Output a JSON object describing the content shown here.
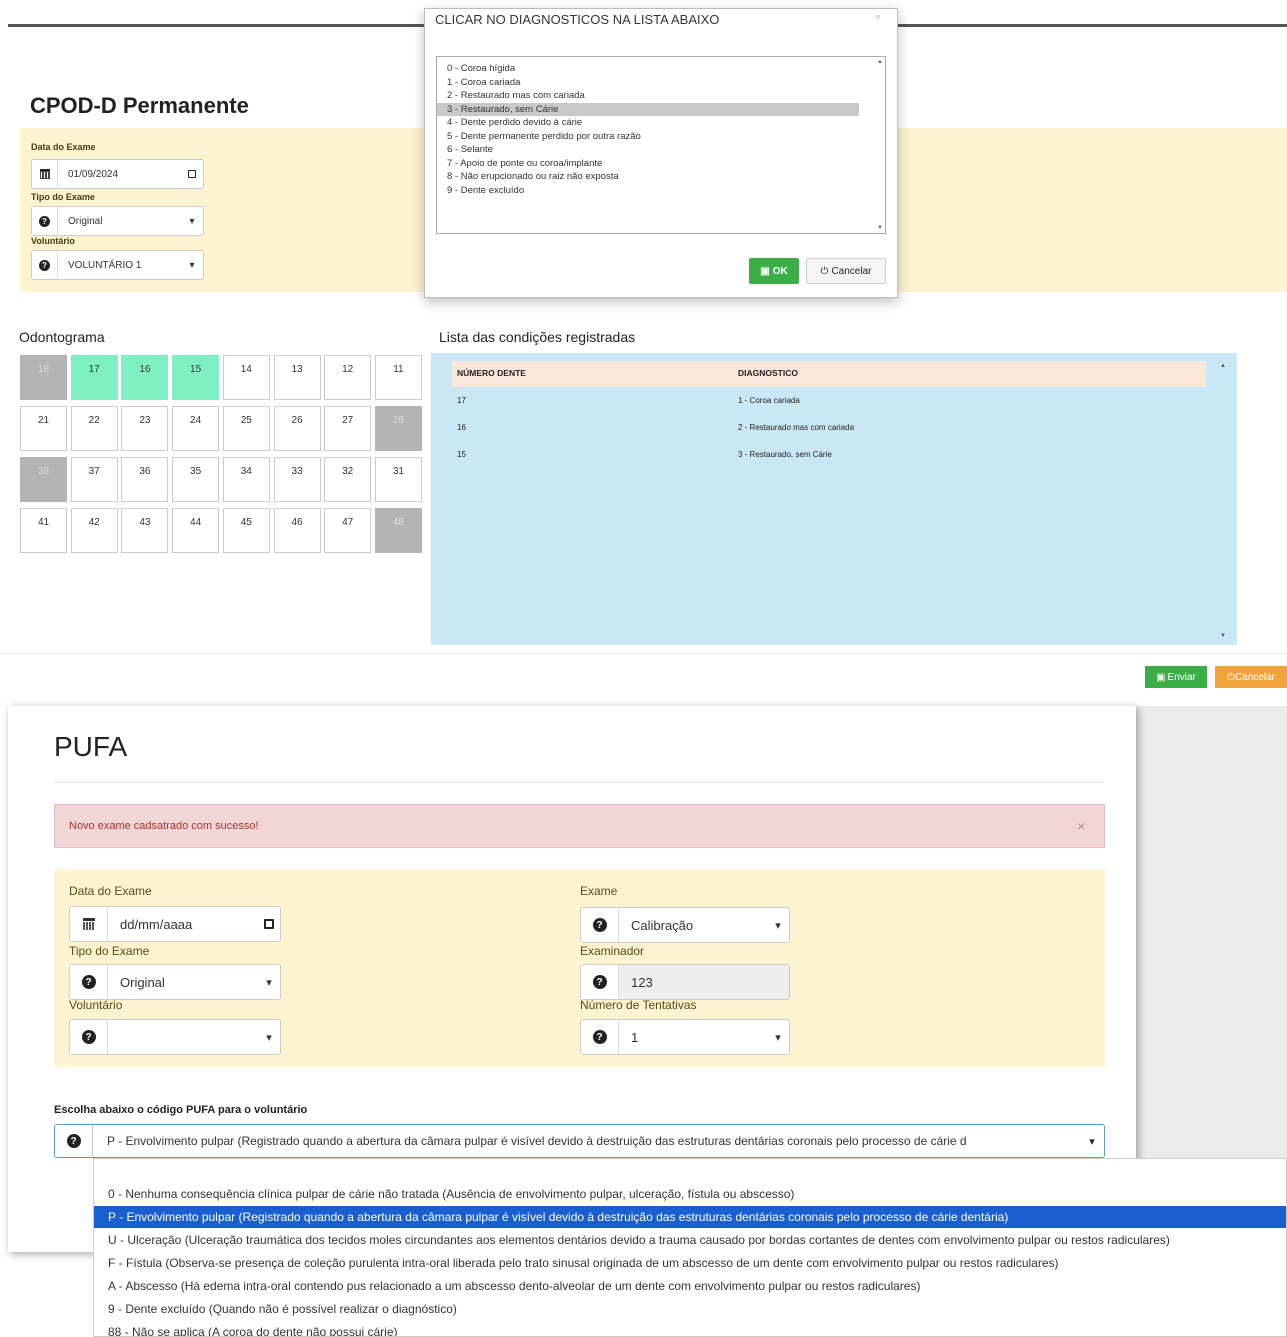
{
  "cpod": {
    "title": "CPOD-D Permanente",
    "date_label": "Data do Exame",
    "date_value": "01/09/2024",
    "tipo_label": "Tipo do Exame",
    "tipo_value": "Original",
    "vol_label": "Voluntário",
    "vol_value": "VOLUNTÁRIO 1"
  },
  "modal": {
    "title": "CLICAR NO DIAGNOSTICOS NA LISTA ABAIXO",
    "close": "×",
    "options": [
      "0 - Coroa hígida",
      "1 - Coroa cariada",
      "2 - Restaurado mas com cariada",
      "3 - Restaurado, sem Cárie",
      "4 - Dente perdido devido à cárie",
      "5 - Dente permanente perdido por outra razão",
      "6 - Selante",
      "7 - Apoio de ponte ou coroa/implante",
      "8 - Não erupcionado ou raiz não exposta",
      "9 - Dente excluído"
    ],
    "selected_index": 3,
    "ok_label": "OK",
    "cancel_label": "Cancelar"
  },
  "odontograma": {
    "title": "Odontograma",
    "rows": [
      [
        {
          "n": "18",
          "s": "x"
        },
        {
          "n": "17",
          "s": "g"
        },
        {
          "n": "16",
          "s": "g"
        },
        {
          "n": "15",
          "s": "g"
        },
        {
          "n": "14",
          "s": ""
        },
        {
          "n": "13",
          "s": ""
        },
        {
          "n": "12",
          "s": ""
        },
        {
          "n": "11",
          "s": ""
        }
      ],
      [
        {
          "n": "21",
          "s": ""
        },
        {
          "n": "22",
          "s": ""
        },
        {
          "n": "23",
          "s": ""
        },
        {
          "n": "24",
          "s": ""
        },
        {
          "n": "25",
          "s": ""
        },
        {
          "n": "26",
          "s": ""
        },
        {
          "n": "27",
          "s": ""
        },
        {
          "n": "28",
          "s": "x"
        }
      ],
      [
        {
          "n": "38",
          "s": "x"
        },
        {
          "n": "37",
          "s": ""
        },
        {
          "n": "36",
          "s": ""
        },
        {
          "n": "35",
          "s": ""
        },
        {
          "n": "34",
          "s": ""
        },
        {
          "n": "33",
          "s": ""
        },
        {
          "n": "32",
          "s": ""
        },
        {
          "n": "31",
          "s": ""
        }
      ],
      [
        {
          "n": "41",
          "s": ""
        },
        {
          "n": "42",
          "s": ""
        },
        {
          "n": "43",
          "s": ""
        },
        {
          "n": "44",
          "s": ""
        },
        {
          "n": "45",
          "s": ""
        },
        {
          "n": "46",
          "s": ""
        },
        {
          "n": "47",
          "s": ""
        },
        {
          "n": "48",
          "s": "x"
        }
      ]
    ]
  },
  "lista": {
    "title": "Lista das condições registradas",
    "col1": "NÚMERO DENTE",
    "col2": "DIAGNOSTICO",
    "rows": [
      {
        "dente": "17",
        "diag": "1 - Coroa cariada"
      },
      {
        "dente": "16",
        "diag": "2 - Restaurado mas com cariada"
      },
      {
        "dente": "15",
        "diag": "3 - Restaurado, sem Cárie"
      }
    ]
  },
  "actions": {
    "enviar": "Enviar",
    "cancelar": "Cancelar"
  },
  "pufa": {
    "title": "PUFA",
    "alert": "Novo exame cadsatrado com sucesso!",
    "alert_close": "×",
    "date_label": "Data do Exame",
    "date_placeholder": "dd/mm/aaaa",
    "tipo_label": "Tipo do Exame",
    "tipo_value": "Original",
    "vol_label": "Voluntário",
    "vol_value": "",
    "exame_label": "Exame",
    "exame_value": "Calibração",
    "examinador_label": "Examinador",
    "examinador_value": "123",
    "tentativas_label": "Número de Tentativas",
    "tentativas_value": "1",
    "choose_label": "Escolha abaixo o código PUFA para o voluntário",
    "selected_value": "P - Envolvimento pulpar (Registrado quando a abertura da câmara pulpar é visível devido à destruição das estruturas dentárias coronais pelo processo de cárie d",
    "options": [
      "0 - Nenhuma consequência clínica pulpar de cárie não tratada (Ausência de envolvimento pulpar, ulceração, fístula ou abscesso)",
      "P - Envolvimento pulpar (Registrado quando a abertura da câmara pulpar é visível devido à destruição das estruturas dentárias coronais pelo processo de cárie dentária)",
      "U - Ulceração (Ulceração traumática dos tecidos moles circundantes aos elementos dentários devido a trauma causado por bordas cortantes de dentes com envolvimento pulpar ou restos radiculares)",
      "F - Fístula (Observa-se presença de coleção purulenta intra-oral liberada pelo trato sinusal originada de um abscesso de um dente com envolvimento pulpar ou restos radiculares)",
      "A - Abscesso (Há edema intra-oral contendo pus relacionado a um abscesso dento-alveolar de um dente com envolvimento pulpar ou restos radiculares)",
      "9 - Dente excluído (Quando não é possível realizar o diagnóstico)",
      "88 - Não se aplica (A coroa do dente não possui cárie)"
    ],
    "selected_index": 1
  },
  "icons": {
    "question": "?",
    "chevron": "⌄",
    "power": "⏻"
  }
}
